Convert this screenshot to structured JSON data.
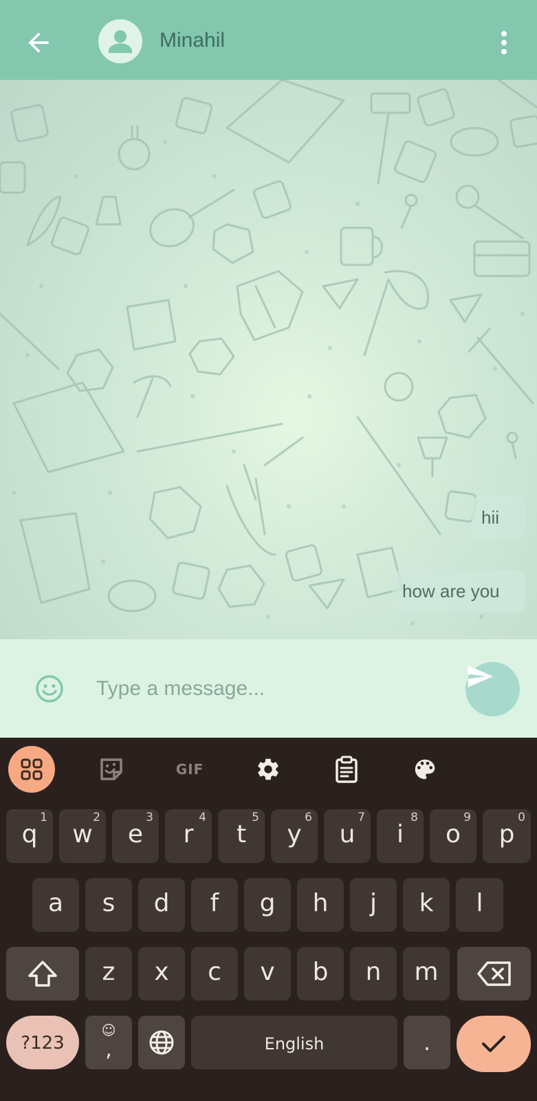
{
  "header": {
    "contact_name": "Minahil",
    "back_icon": "arrow-left-icon",
    "avatar_icon": "person-icon",
    "menu_icon": "more-vertical-icon",
    "color": "#82c7ae"
  },
  "chat": {
    "messages": [
      {
        "text": "hii",
        "direction": "outgoing"
      },
      {
        "text": "how are you",
        "direction": "outgoing"
      }
    ]
  },
  "composer": {
    "placeholder": "Type a message...",
    "emoji_icon": "smiley-icon",
    "send_icon": "send-icon"
  },
  "keyboard": {
    "toolbar": [
      {
        "name": "apps-grid-icon"
      },
      {
        "name": "sticker-icon"
      },
      {
        "name": "gif-icon",
        "label": "GIF"
      },
      {
        "name": "settings-gear-icon"
      },
      {
        "name": "clipboard-icon"
      },
      {
        "name": "palette-icon"
      }
    ],
    "rows": [
      [
        {
          "key": "q",
          "hint": "1"
        },
        {
          "key": "w",
          "hint": "2"
        },
        {
          "key": "e",
          "hint": "3"
        },
        {
          "key": "r",
          "hint": "4"
        },
        {
          "key": "t",
          "hint": "5"
        },
        {
          "key": "y",
          "hint": "6"
        },
        {
          "key": "u",
          "hint": "7"
        },
        {
          "key": "i",
          "hint": "8"
        },
        {
          "key": "o",
          "hint": "9"
        },
        {
          "key": "p",
          "hint": "0"
        }
      ],
      [
        {
          "key": "a"
        },
        {
          "key": "s"
        },
        {
          "key": "d"
        },
        {
          "key": "f"
        },
        {
          "key": "g"
        },
        {
          "key": "h"
        },
        {
          "key": "j"
        },
        {
          "key": "k"
        },
        {
          "key": "l"
        }
      ],
      [
        {
          "key": "z"
        },
        {
          "key": "x"
        },
        {
          "key": "c"
        },
        {
          "key": "v"
        },
        {
          "key": "b"
        },
        {
          "key": "n"
        },
        {
          "key": "m"
        }
      ]
    ],
    "shift_icon": "shift-arrow-icon",
    "backspace_icon": "backspace-icon",
    "symbols_label": "?123",
    "emoji_comma": {
      "emoji": "☺",
      "char": ","
    },
    "globe_icon": "globe-icon",
    "space_label": "English",
    "period_label": ".",
    "enter_icon": "checkmark-icon",
    "accent_color": "#f6b494"
  }
}
